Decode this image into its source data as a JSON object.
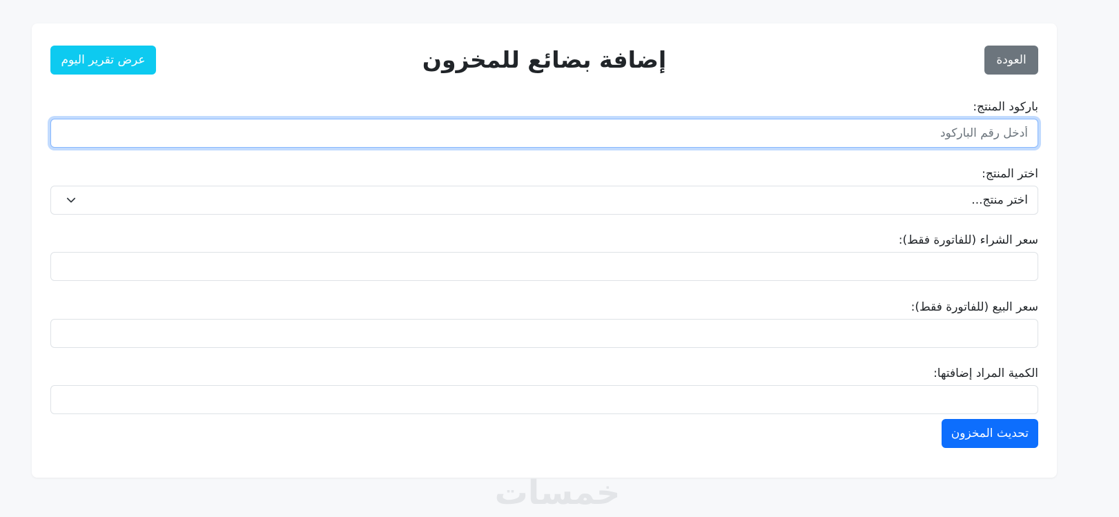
{
  "header": {
    "back_label": "العودة",
    "title": "إضافة بضائع للمخزون",
    "report_label": "عرض تقرير اليوم"
  },
  "form": {
    "barcode": {
      "label": "باركود المنتج:",
      "placeholder": "أدخل رقم الباركود",
      "value": ""
    },
    "product": {
      "label": "اختر المنتج:",
      "selected": "اختر منتج..."
    },
    "purchase_price": {
      "label": "سعر الشراء (للفاتورة فقط):",
      "value": ""
    },
    "sale_price": {
      "label": "سعر البيع (للفاتورة فقط):",
      "value": ""
    },
    "quantity": {
      "label": "الكمية المراد إضافتها:",
      "value": ""
    },
    "submit_label": "تحديث المخزون"
  },
  "colors": {
    "back_button": "#6c757d",
    "report_button": "#0dcaf0",
    "submit_button": "#0d6efd",
    "focus_ring": "#86b7fe"
  },
  "icons": {
    "select_chevron": "chevron-down-icon"
  },
  "watermark": "خمسات"
}
